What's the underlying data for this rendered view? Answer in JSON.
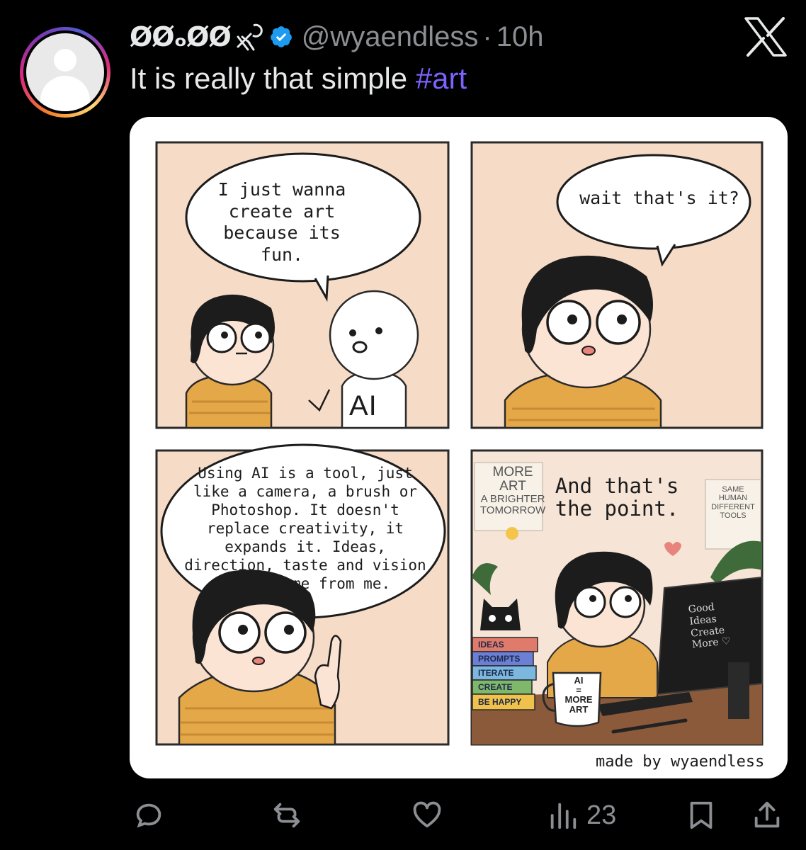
{
  "post": {
    "display_name": "ØØₒØØ",
    "handle": "@wyaendless",
    "separator": "·",
    "time": "10h",
    "text": "It is really that simple ",
    "hashtag": "#art"
  },
  "comic": {
    "panel1_speech": "I just wanna create art because its fun.",
    "panel1_shirt": "AI",
    "panel2_speech": "wait that's it?",
    "panel3_speech_a": "Using AI is a tool, just like a camera, a brush or Photoshop. It doesn't replace creativity, it expands it. Ideas, direction, taste",
    "panel3_speech_b": "and vision still come from me.",
    "panel4_speech": "And that's the point.",
    "poster_left_line1": "MORE",
    "poster_left_line2": "ART",
    "poster_left_line3": "A BRIGHTER",
    "poster_left_line4": "TOMORROW",
    "poster_right": "SAME HUMAN DIFFERENT TOOLS",
    "monitor_line1": "Good",
    "monitor_line2": "Ideas",
    "monitor_line3": "Create",
    "monitor_line4": "More ♡",
    "mug_line1": "AI",
    "mug_line2": "=",
    "mug_line3": "MORE",
    "mug_line4": "ART",
    "books": [
      "IDEAS",
      "PROMPTS",
      "ITERATE",
      "CREATE",
      "BE HAPPY"
    ],
    "credit": "made by wyaendless"
  },
  "actions": {
    "views": "23"
  },
  "icons": {
    "close": "x-logo-icon",
    "verified": "verified-badge-icon",
    "reply": "reply-icon",
    "repost": "repost-icon",
    "like": "heart-icon",
    "views": "views-chart-icon",
    "bookmark": "bookmark-icon",
    "share": "share-icon"
  },
  "colors": {
    "background": "#000000",
    "text": "#e7e9ea",
    "muted": "#8b8f93",
    "hashtag": "#7b63ff",
    "verified": "#1d9bf0",
    "panel_bg": "#f6dcc7",
    "hoodie": "#e5a849"
  }
}
